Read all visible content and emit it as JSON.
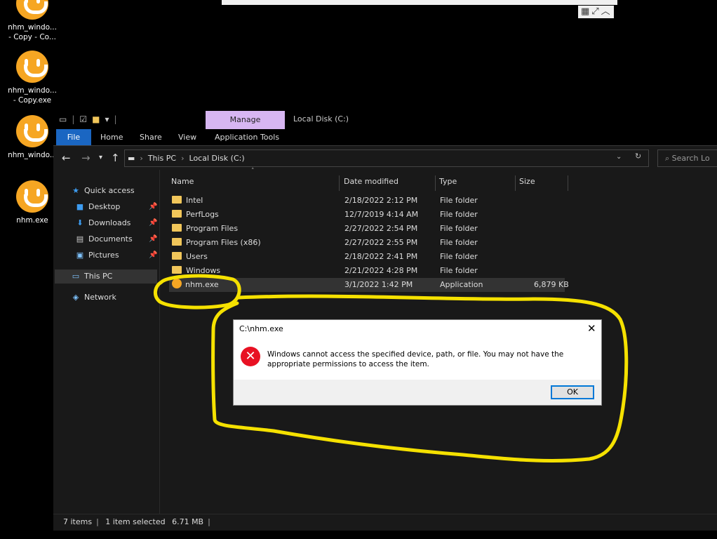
{
  "desktop": {
    "icons": [
      {
        "label": "nhm_windo... - Copy - Co..."
      },
      {
        "label": "nhm_windo... - Copy.exe"
      },
      {
        "label": "nhm_windo..."
      },
      {
        "label": "nhm.exe"
      }
    ]
  },
  "explorer": {
    "window_title": "Local Disk (C:)",
    "contextual_tab": "Manage",
    "ribbon_tabs": [
      "File",
      "Home",
      "Share",
      "View",
      "Application Tools"
    ],
    "breadcrumbs": [
      "This PC",
      "Local Disk (C:)"
    ],
    "search_placeholder": "Search Lo",
    "nav": {
      "quick_access": "Quick access",
      "items": [
        "Desktop",
        "Downloads",
        "Documents",
        "Pictures"
      ],
      "this_pc": "This PC",
      "network": "Network"
    },
    "columns": [
      "Name",
      "Date modified",
      "Type",
      "Size"
    ],
    "files": [
      {
        "name": "Intel",
        "date": "2/18/2022 2:12 PM",
        "type": "File folder",
        "size": ""
      },
      {
        "name": "PerfLogs",
        "date": "12/7/2019 4:14 AM",
        "type": "File folder",
        "size": ""
      },
      {
        "name": "Program Files",
        "date": "2/27/2022 2:54 PM",
        "type": "File folder",
        "size": ""
      },
      {
        "name": "Program Files (x86)",
        "date": "2/27/2022 2:55 PM",
        "type": "File folder",
        "size": ""
      },
      {
        "name": "Users",
        "date": "2/18/2022 2:41 PM",
        "type": "File folder",
        "size": ""
      },
      {
        "name": "Windows",
        "date": "2/21/2022 4:28 PM",
        "type": "File folder",
        "size": ""
      },
      {
        "name": "nhm.exe",
        "date": "3/1/2022 1:42 PM",
        "type": "Application",
        "size": "6,879 KB"
      }
    ],
    "status": {
      "count": "7 items",
      "selected": "1 item selected",
      "size": "6.71 MB"
    }
  },
  "dialog": {
    "title": "C:\\nhm.exe",
    "message": "Windows cannot access the specified device, path, or file. You may not have the appropriate permissions to access the item.",
    "ok_label": "OK"
  },
  "colors": {
    "accent": "#1a66c2",
    "manage_tab": "#d7b6f2",
    "annotation": "#f5e100",
    "error": "#e81123"
  }
}
